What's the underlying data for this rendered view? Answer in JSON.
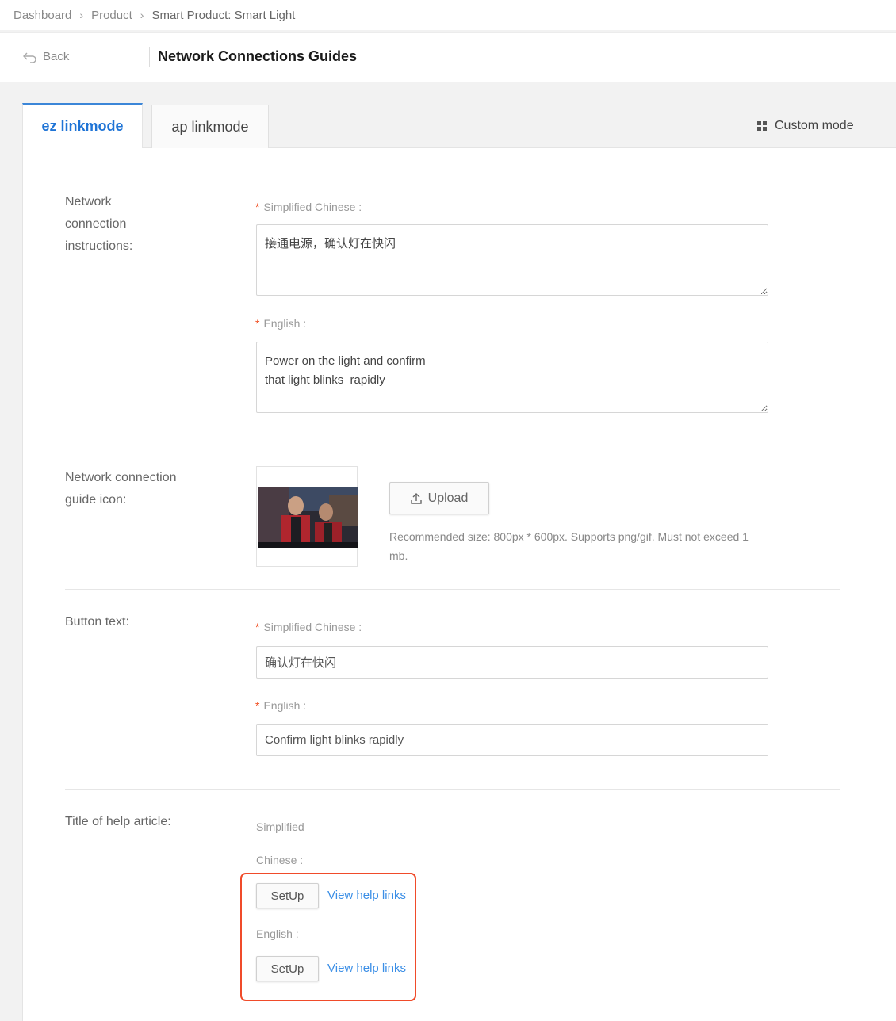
{
  "breadcrumb": {
    "items": [
      "Dashboard",
      "Product",
      "Smart Product: Smart Light"
    ]
  },
  "header": {
    "back_label": "Back",
    "title": "Network Connections Guides"
  },
  "tabs": [
    {
      "label": "ez linkmode",
      "active": true
    },
    {
      "label": "ap linkmode",
      "active": false
    }
  ],
  "custom_mode_label": "Custom mode",
  "sections": {
    "instructions": {
      "label": "Network connection instructions:",
      "zh_label": "Simplified Chinese :",
      "zh_value": "接通电源，确认灯在快闪",
      "en_label": "English :",
      "en_value": "Power on the light and confirm\nthat light blinks  rapidly"
    },
    "icon": {
      "label": "Network connection guide icon:",
      "upload_label": "Upload",
      "hint": "Recommended size: 800px * 600px. Supports png/gif. Must not exceed 1 mb."
    },
    "button_text": {
      "label": "Button text:",
      "zh_label": "Simplified Chinese :",
      "zh_value": "确认灯在快闪",
      "en_label": "English :",
      "en_value": "Confirm light blinks rapidly"
    },
    "help": {
      "label": "Title of help article:",
      "zh_label_line1": "Simplified",
      "zh_label_line2": "Chinese :",
      "setup_label_zh": "SetUp",
      "link_zh": "View help links",
      "en_label": "English :",
      "setup_label_en": "SetUp",
      "link_en": "View help links"
    }
  },
  "colors": {
    "accent": "#1f74d6",
    "link": "#3a8ee6",
    "required": "#f04b1d",
    "highlight": "#f04b2a"
  }
}
